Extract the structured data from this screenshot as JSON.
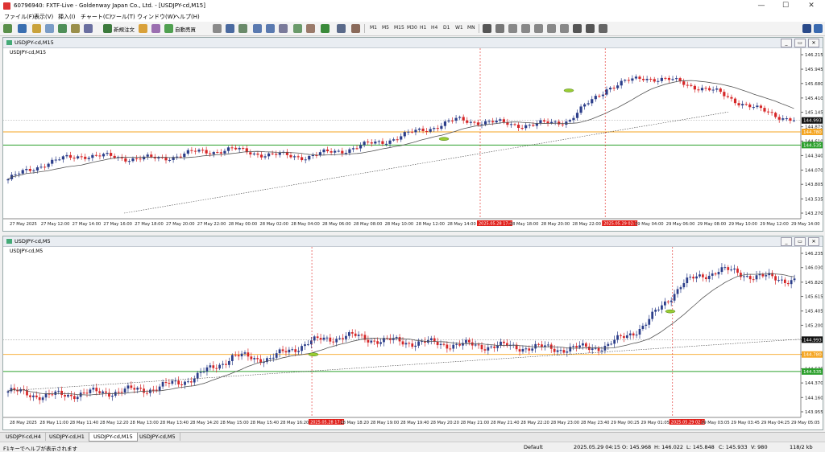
{
  "window": {
    "title": "60796940: FXTF-Live - Goldenway Japan Co., Ltd. - [USDJPY-cd,M15]",
    "minimize": "—",
    "maximize": "☐",
    "close": "✕"
  },
  "menu": [
    "ファイル(F)",
    "表示(V)",
    "挿入(I)",
    "チャート(C)",
    "ツール(T)",
    "ウィンドウ(W)",
    "ヘルプ(H)"
  ],
  "toolbar": {
    "new_order": "新規注文",
    "auto_trade": "自動売買",
    "timeframes": [
      "M1",
      "M5",
      "M15",
      "M30",
      "H1",
      "H4",
      "D1",
      "W1",
      "MN"
    ]
  },
  "colors": {
    "up": "#2c3e8a",
    "down": "#d62728",
    "ma": "#555555",
    "orange_line": "#f5a623",
    "green_line": "#2ca02c",
    "price_tag": "#000000",
    "red_marker": "#e0201b"
  },
  "chart_top": {
    "window_title": "USDJPY-cd,M15",
    "label": "USDJPY-cd,M15",
    "y_ticks": [
      "146.215",
      "145.945",
      "145.680",
      "145.410",
      "145.145",
      "144.875",
      "144.610",
      "144.340",
      "144.070",
      "143.805",
      "143.535",
      "143.270"
    ],
    "price_tags": {
      "current": "144.993",
      "orange": "144.780",
      "green": "144.535"
    },
    "x_ticks": [
      "27 May 2025",
      "27 May 12:00",
      "27 May 14:00",
      "27 May 16:00",
      "27 May 18:00",
      "27 May 20:00",
      "27 May 22:00",
      "28 May 00:00",
      "28 May 02:00",
      "28 May 04:00",
      "28 May 06:00",
      "28 May 08:00",
      "28 May 10:00",
      "28 May 12:00",
      "28 May 14:00",
      "2025.05.28 17:45",
      "28 May 18:00",
      "28 May 20:00",
      "28 May 22:00",
      "2025.05.29 02:15",
      "29 May 04:00",
      "29 May 06:00",
      "29 May 08:00",
      "29 May 10:00",
      "29 May 12:00",
      "29 May 14:00"
    ]
  },
  "chart_bottom": {
    "window_title": "USDJPY-cd,M5",
    "label": "USDJPY-cd,M5",
    "y_ticks": [
      "146.235",
      "146.030",
      "145.820",
      "145.615",
      "145.405",
      "145.200",
      "144.993",
      "144.780",
      "144.575",
      "144.370",
      "144.160",
      "143.955"
    ],
    "price_tags": {
      "current": "144.993",
      "orange": "144.780",
      "green": "144.535"
    },
    "x_ticks": [
      "28 May 2025",
      "28 May 11:00",
      "28 May 11:40",
      "28 May 12:20",
      "28 May 13:00",
      "28 May 13:40",
      "28 May 14:20",
      "28 May 15:00",
      "28 May 15:40",
      "28 May 16:20",
      "2025.05.28 17:45",
      "28 May 18:20",
      "28 May 19:00",
      "28 May 19:40",
      "28 May 20:20",
      "28 May 21:00",
      "28 May 21:40",
      "28 May 22:20",
      "28 May 23:00",
      "28 May 23:40",
      "29 May 00:25",
      "29 May 01:05",
      "2025.05.29 02:15",
      "29 May 03:05",
      "29 May 03:45",
      "29 May 04:25",
      "29 May 05:05"
    ]
  },
  "tabs": [
    "USDJPY-cd,H4",
    "USDJPY-cd,H1",
    "USDJPY-cd,M15",
    "USDJPY-cd,M5"
  ],
  "active_tab": 2,
  "status": {
    "help": "F1キーでヘルプが表示されます",
    "profile": "Default",
    "datetime": "2025.05.29 04:15",
    "open": "O: 145.968",
    "high": "H: 146.022",
    "low": "L: 145.848",
    "close": "C: 145.933",
    "volume": "V: 980",
    "traffic": "118/2 kb"
  }
}
